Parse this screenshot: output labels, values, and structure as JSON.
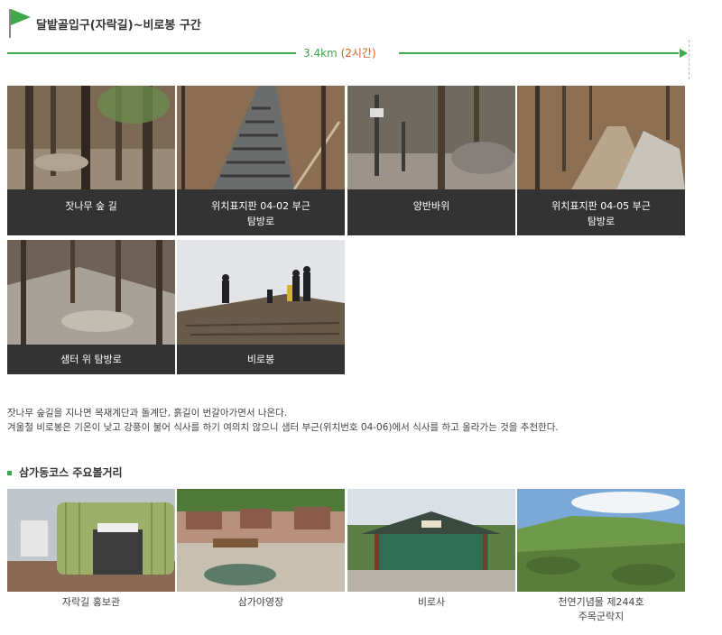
{
  "section": {
    "title": "달밭골입구(자락길)~비로봉 구간",
    "distance": "3.4km",
    "duration": "(2시간)"
  },
  "trail_photos": [
    {
      "caption_1": "잣나무 숲 길",
      "caption_2": ""
    },
    {
      "caption_1": "위치표지판 04-02 부근",
      "caption_2": "탐방로"
    },
    {
      "caption_1": "양반바위",
      "caption_2": ""
    },
    {
      "caption_1": "위치표지판 04-05 부근",
      "caption_2": "탐방로"
    },
    {
      "caption_1": "샘터 위 탐방로",
      "caption_2": ""
    },
    {
      "caption_1": "비로봉",
      "caption_2": ""
    }
  ],
  "description": {
    "line_1": "잣나무 숲길을 지나면 목재계단과 돌계단, 흙길이 번갈아가면서 나온다.",
    "line_2": "겨울철 비로봉은 기온이 낮고 강풍이 불어 식사를 하기 여의치 않으니 샘터 부근(위치번호 04-06)에서 식사를 하고 올라가는 것을 추천한다."
  },
  "attractions": {
    "title": "삼가동코스 주요볼거리",
    "items": [
      {
        "caption_1": "자락길 홍보관",
        "caption_2": ""
      },
      {
        "caption_1": "삼가야영장",
        "caption_2": ""
      },
      {
        "caption_1": "비로사",
        "caption_2": ""
      },
      {
        "caption_1": "천연기념물 제244호",
        "caption_2": "주목군락지"
      }
    ]
  },
  "colors": {
    "accent_green": "#3fa84a",
    "time_orange": "#e25a1c",
    "caption_bg": "#333333"
  }
}
